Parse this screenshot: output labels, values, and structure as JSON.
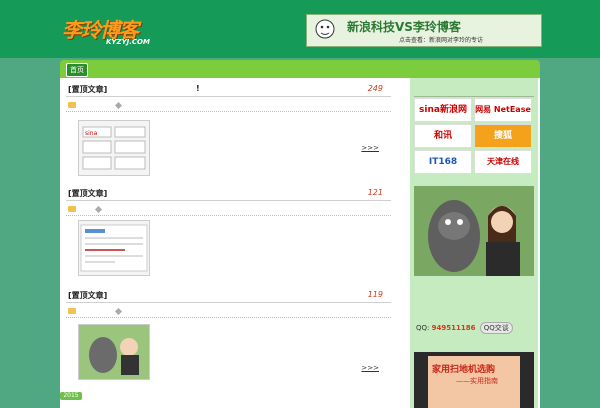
{
  "header": {
    "logo_text": "李玲博客",
    "logo_sub": "KYZYJ.COM",
    "banner_title": "新浪科技VS李玲博客",
    "banner_sub": "点击查看：新浪网对李玲的专访"
  },
  "nav": {
    "items": [
      "首页",
      "",
      "",
      "",
      "",
      "",
      ""
    ]
  },
  "posts": [
    {
      "title": "[置顶文章]",
      "title_suffix": "!",
      "count": "249",
      "cat": "",
      "tag": "",
      "label": "",
      "excerpt": "",
      "more": ">>>"
    },
    {
      "title": "[置顶文章]",
      "count": "121",
      "cat": "",
      "tag": "",
      "label": "",
      "excerpt": "",
      "more": ">>>"
    },
    {
      "title": "[置顶文章]",
      "count": "119",
      "cat": "",
      "tag": "",
      "label": "",
      "excerpt": "",
      "more": ">>>"
    }
  ],
  "sidebar": {
    "partners": [
      "sina新浪网",
      "网易 NetEase",
      "和讯",
      "搜狐",
      "IT168",
      "天津在线"
    ],
    "qq_label": "QQ:",
    "qq_number": "949511186",
    "qq_button": "QQ交谈",
    "book_title": "家用扫地机选购",
    "book_sub": "——实用指南"
  },
  "footer": {
    "year": "2015"
  },
  "colors": {
    "header_bg": "#159a58",
    "page_bg": "#4fa882",
    "nav_bg": "#7ccd3e",
    "accent": "#d03a1a"
  }
}
